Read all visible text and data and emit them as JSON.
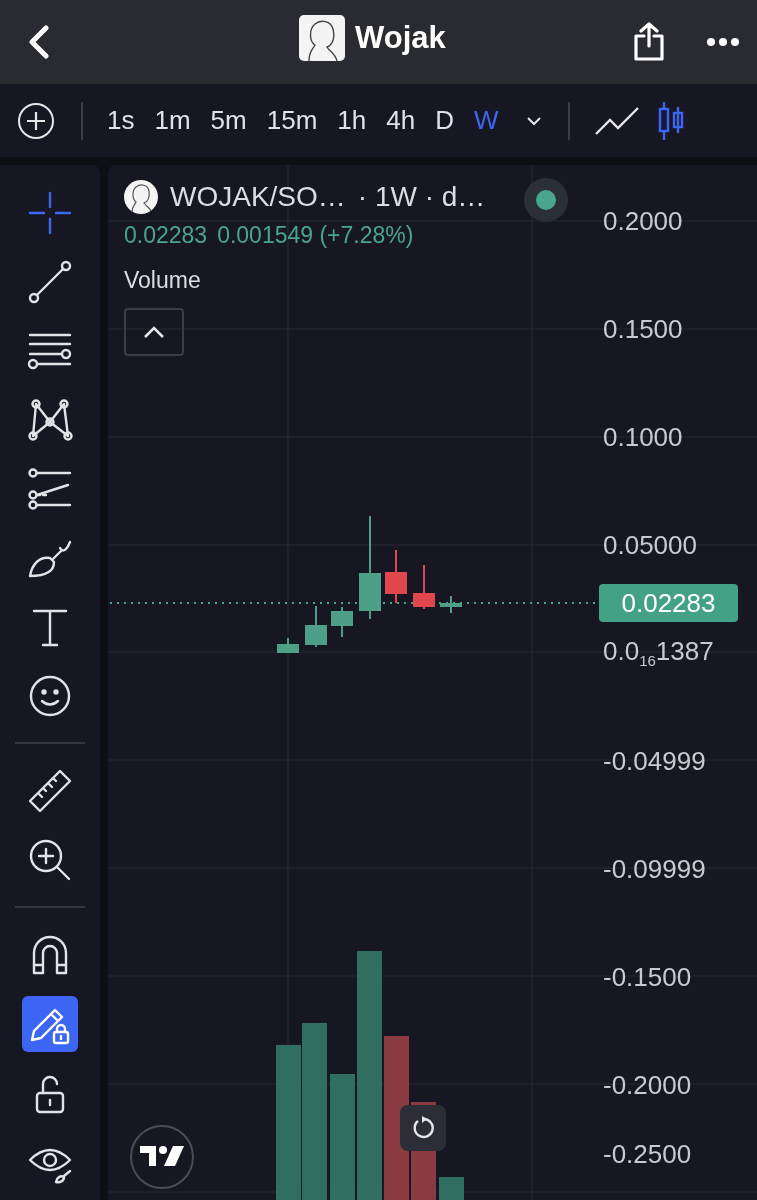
{
  "header": {
    "title": "Wojak"
  },
  "timeframes": [
    {
      "label": "1s",
      "selected": false
    },
    {
      "label": "1m",
      "selected": false
    },
    {
      "label": "5m",
      "selected": false
    },
    {
      "label": "15m",
      "selected": false
    },
    {
      "label": "1h",
      "selected": false
    },
    {
      "label": "4h",
      "selected": false
    },
    {
      "label": "D",
      "selected": false
    },
    {
      "label": "W",
      "selected": true
    }
  ],
  "chart_types": [
    {
      "kind": "line",
      "selected": false
    },
    {
      "kind": "candles",
      "selected": true
    }
  ],
  "tool_groups": [
    {
      "tools": [
        {
          "kind": "crosshair",
          "selected": true
        },
        {
          "kind": "trend-line",
          "selected": false
        },
        {
          "kind": "levels",
          "selected": false
        },
        {
          "kind": "pattern",
          "selected": false
        },
        {
          "kind": "projection",
          "selected": false
        },
        {
          "kind": "brush",
          "selected": false
        },
        {
          "kind": "text",
          "selected": false
        },
        {
          "kind": "emoji",
          "selected": false
        }
      ]
    },
    {
      "tools": [
        {
          "kind": "ruler",
          "selected": false
        },
        {
          "kind": "zoom",
          "selected": false
        }
      ]
    },
    {
      "tools": [
        {
          "kind": "magnet",
          "selected": false
        },
        {
          "kind": "lock-drawings",
          "selected": true
        },
        {
          "kind": "unlock",
          "selected": false
        },
        {
          "kind": "eye",
          "selected": false
        }
      ]
    }
  ],
  "legend": {
    "symbol": "WOJAK/SO…",
    "interval": "· 1W · d…",
    "price": "0.02283",
    "change": "0.001549 (+7.28%)",
    "volume_label": "Volume"
  },
  "chart": {
    "price_axis": [
      "0.2000",
      "0.1500",
      "0.1000",
      "0.05000",
      "0.0$_{16}$1387",
      "-0.04999",
      "-0.09999",
      "-0.1500",
      "-0.2000",
      "-0.2500"
    ],
    "last_price": "0.02283"
  }
}
